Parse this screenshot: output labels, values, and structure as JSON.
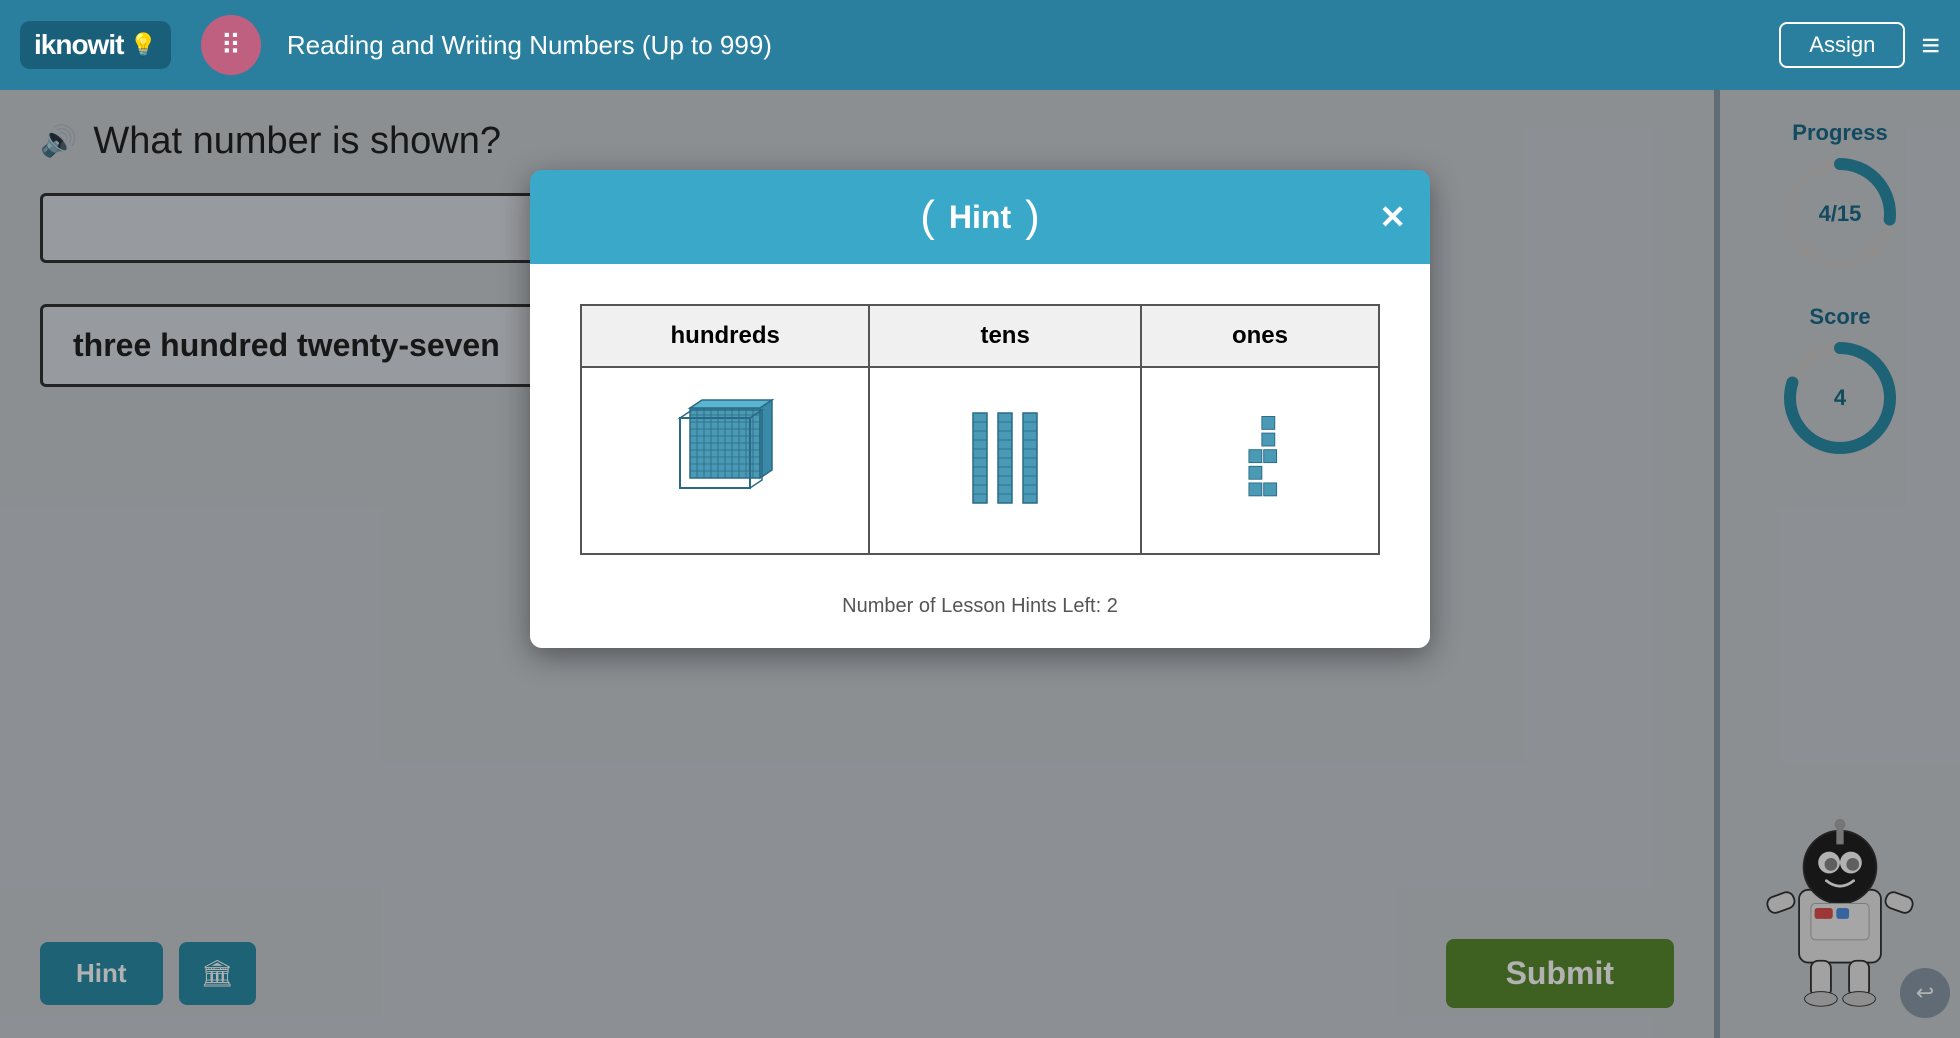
{
  "header": {
    "logo_text": "iknowit",
    "lesson_title": "Reading and Writing Numbers (Up to 999)",
    "assign_label": "Assign",
    "menu_icon": "≡"
  },
  "question": {
    "text": "What number is shown?",
    "speaker_icon": "🔊"
  },
  "answers": {
    "blank_box": "",
    "text_answer": "three hundred twenty-seven"
  },
  "buttons": {
    "hint_label": "Hint",
    "home_icon": "🏛",
    "submit_label": "Submit"
  },
  "progress": {
    "label": "Progress",
    "value": "4/15",
    "score_label": "Score",
    "score_value": "4",
    "progress_percent": 26.7,
    "score_percent": 80
  },
  "hint_modal": {
    "title": "Hint",
    "close_icon": "✕",
    "paren_left": "(",
    "paren_right": ")",
    "table": {
      "headers": [
        "hundreds",
        "tens",
        "ones"
      ],
      "footer": "Number of Lesson Hints Left: 2"
    }
  },
  "back_icon": "↩"
}
